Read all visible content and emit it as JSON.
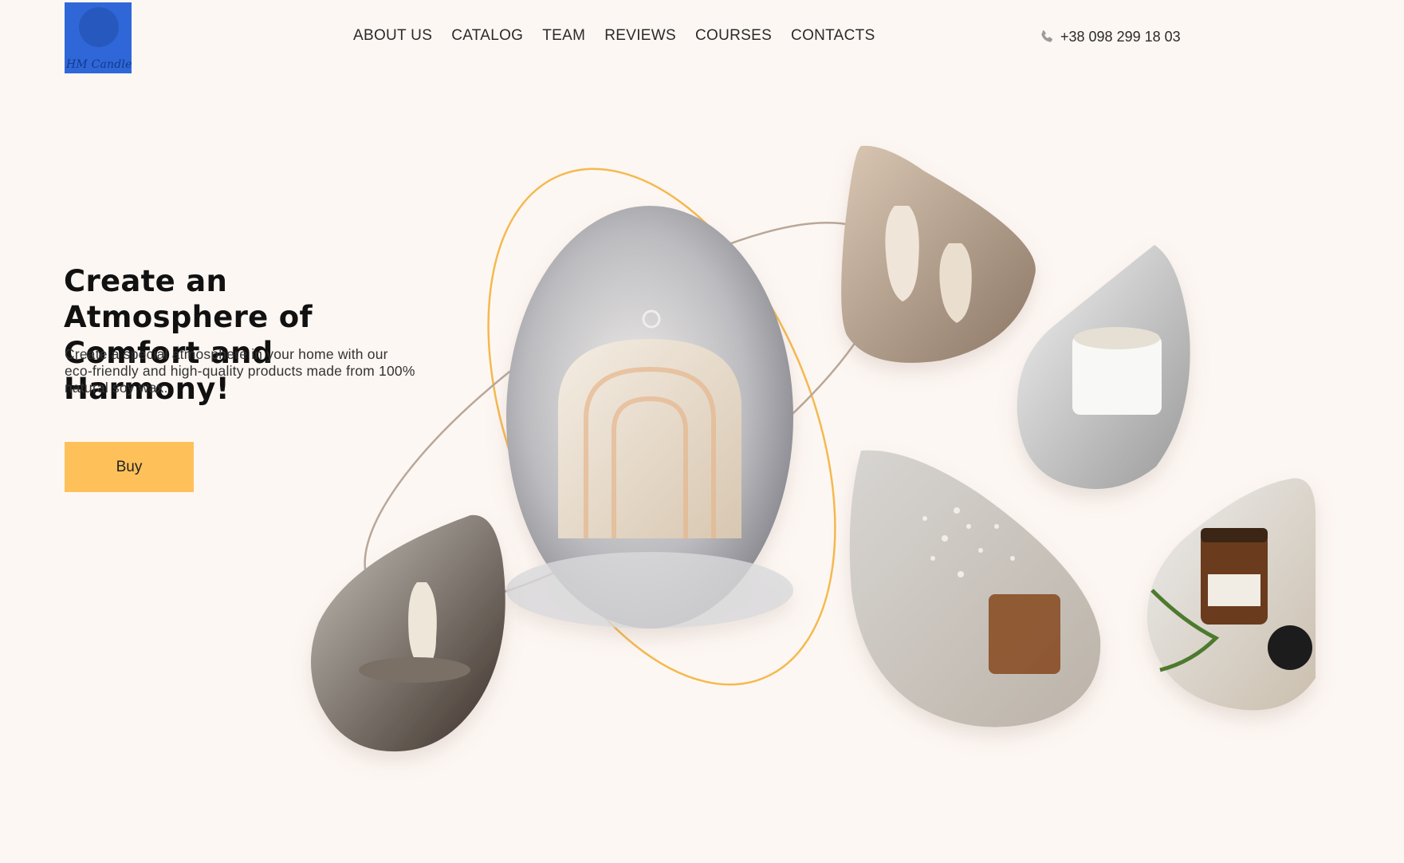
{
  "header": {
    "logo_text": "HM Candles",
    "nav": [
      "ABOUT US",
      "CATALOG",
      "TEAM",
      "REVIEWS",
      "COURSES",
      "CONTACTS"
    ],
    "phone": "+38 098 299 18 03",
    "phone_icon": "phone-icon"
  },
  "hero": {
    "title": "Create an Atmosphere of Comfort and Harmony!",
    "subtitle": "Create a special atmosphere in your home with our eco-friendly and high-quality products made from 100% natural soy wax.",
    "buy_label": "Buy"
  },
  "colors": {
    "background": "#fdf7f3",
    "accent": "#fec15a",
    "orbit_gold": "#f5b94f",
    "orbit_taupe": "#b9a79a",
    "logo_blue": "#2f67d8"
  }
}
